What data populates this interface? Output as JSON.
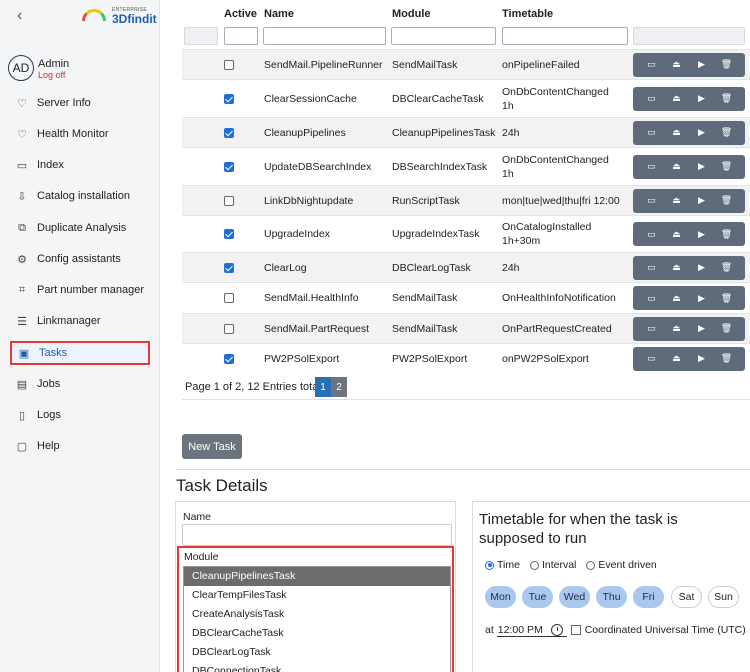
{
  "app": {
    "logo_small": "ENTERPRISE",
    "logo_brand": "3Dfindit"
  },
  "user": {
    "initials": "AD",
    "name": "Admin",
    "logoff": "Log off"
  },
  "sidebar": {
    "items": [
      {
        "label": "Server Info",
        "icon": "lightbulb-icon",
        "glyph": "♡"
      },
      {
        "label": "Health Monitor",
        "icon": "heart-icon",
        "glyph": "♡"
      },
      {
        "label": "Index",
        "icon": "file-icon",
        "glyph": "▭"
      },
      {
        "label": "Catalog installation",
        "icon": "install-icon",
        "glyph": "⇩"
      },
      {
        "label": "Duplicate Analysis",
        "icon": "duplicate-icon",
        "glyph": "⧉"
      },
      {
        "label": "Config assistants",
        "icon": "gear-icon",
        "glyph": "⚙"
      },
      {
        "label": "Part number manager",
        "icon": "partnumber-icon",
        "glyph": "⌗"
      },
      {
        "label": "Linkmanager",
        "icon": "database-icon",
        "glyph": "☰"
      },
      {
        "label": "Tasks",
        "icon": "tasks-icon",
        "glyph": "▣"
      },
      {
        "label": "Jobs",
        "icon": "jobs-icon",
        "glyph": "▤"
      },
      {
        "label": "Logs",
        "icon": "logs-icon",
        "glyph": "▯"
      },
      {
        "label": "Help",
        "icon": "help-icon",
        "glyph": "▢"
      }
    ],
    "active_index": 8
  },
  "table": {
    "headers": {
      "active": "Active",
      "name": "Name",
      "module": "Module",
      "timetable": "Timetable"
    },
    "rows": [
      {
        "active": false,
        "name": "SendMail.PipelineRunner",
        "module": "SendMailTask",
        "timetable": [
          "onPipelineFailed"
        ]
      },
      {
        "active": true,
        "name": "ClearSessionCache",
        "module": "DBClearCacheTask",
        "timetable": [
          "OnDbContentChanged",
          "1h"
        ]
      },
      {
        "active": true,
        "name": "CleanupPipelines",
        "module": "CleanupPipelinesTask",
        "timetable": [
          "24h"
        ]
      },
      {
        "active": true,
        "name": "UpdateDBSearchIndex",
        "module": "DBSearchIndexTask",
        "timetable": [
          "OnDbContentChanged",
          "1h"
        ]
      },
      {
        "active": false,
        "name": "LinkDbNightupdate",
        "module": "RunScriptTask",
        "timetable": [
          "mon|tue|wed|thu|fri 12:00"
        ]
      },
      {
        "active": true,
        "name": "UpgradeIndex",
        "module": "UpgradeIndexTask",
        "timetable": [
          "OnCatalogInstalled",
          "1h+30m"
        ]
      },
      {
        "active": true,
        "name": "ClearLog",
        "module": "DBClearLogTask",
        "timetable": [
          "24h"
        ]
      },
      {
        "active": false,
        "name": "SendMail.HealthInfo",
        "module": "SendMailTask",
        "timetable": [
          "OnHealthInfoNotification"
        ]
      },
      {
        "active": false,
        "name": "SendMail.PartRequest",
        "module": "SendMailTask",
        "timetable": [
          "OnPartRequestCreated"
        ]
      },
      {
        "active": true,
        "name": "PW2PSolExport",
        "module": "PW2PSolExport",
        "timetable": [
          "onPW2PSolExport"
        ]
      }
    ],
    "pager_text": "Page 1 of 2, 12 Entries total:",
    "pages": [
      "1",
      "2"
    ],
    "current_page": "1",
    "new_task_label": "New Task"
  },
  "task_details": {
    "title": "Task Details",
    "name_label": "Name",
    "name_value": "",
    "module_label": "Module",
    "module_options": [
      "CleanupPipelinesTask",
      "ClearTempFilesTask",
      "CreateAnalysisTask",
      "DBClearCacheTask",
      "DBClearLogTask",
      "DBConnectionTask"
    ],
    "module_selected": "CleanupPipelinesTask",
    "timetable_title": "Timetable for when the task is supposed to run",
    "modes": [
      "Time",
      "Interval",
      "Event driven"
    ],
    "mode_selected": "Time",
    "days": [
      {
        "label": "Mon",
        "on": true
      },
      {
        "label": "Tue",
        "on": true
      },
      {
        "label": "Wed",
        "on": true
      },
      {
        "label": "Thu",
        "on": true
      },
      {
        "label": "Fri",
        "on": true
      },
      {
        "label": "Sat",
        "on": false
      },
      {
        "label": "Sun",
        "on": false
      }
    ],
    "at_label": "at",
    "time_value": "12:00 PM",
    "utc_label": "Coordinated Universal Time (UTC)",
    "utc_checked": false
  },
  "colors": {
    "accent": "#1e6fdc",
    "active_nav_border": "#e53935",
    "action_bar": "#5f6b7a",
    "day_on": "#aac8ee"
  }
}
